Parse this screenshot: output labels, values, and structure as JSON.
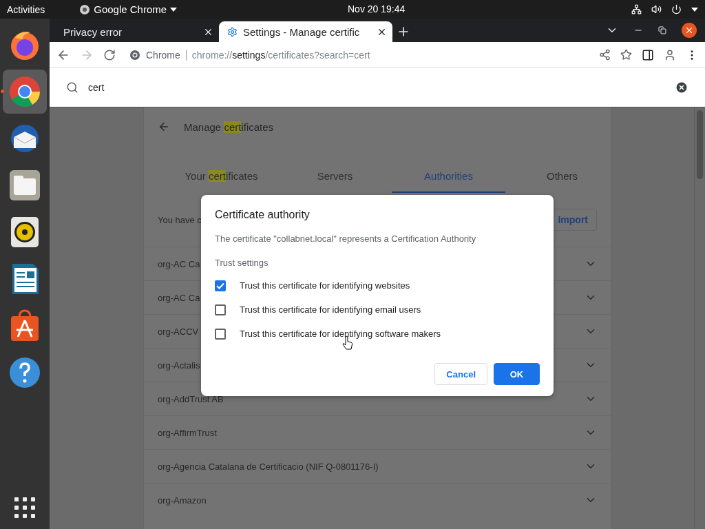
{
  "top_bar": {
    "activities": "Activities",
    "app_menu": "Google Chrome",
    "clock": "Nov 20  19:44"
  },
  "dock": [
    {
      "kind": "firefox",
      "selected": false
    },
    {
      "kind": "chrome",
      "selected": true
    },
    {
      "kind": "mail",
      "selected": false
    },
    {
      "kind": "files",
      "selected": false
    },
    {
      "kind": "music",
      "selected": false
    },
    {
      "kind": "writer",
      "selected": false
    },
    {
      "kind": "software",
      "selected": false
    },
    {
      "kind": "help",
      "selected": false
    }
  ],
  "tabs": [
    {
      "title": "Privacy error",
      "selected": false
    },
    {
      "title": "Settings - Manage certific",
      "selected": true
    }
  ],
  "address_bar": {
    "site": "Chrome",
    "url": [
      {
        "text": "chrome://",
        "emphasis": false
      },
      {
        "text": "settings",
        "emphasis": true
      },
      {
        "text": "/certificates?search=cert",
        "emphasis": false
      }
    ]
  },
  "settings_search": {
    "value": "cert"
  },
  "page": {
    "title": [
      {
        "text": "Manage ",
        "highlighted": false
      },
      {
        "text": "cert",
        "highlighted": true
      },
      {
        "text": "ificates",
        "highlighted": false
      }
    ],
    "tabs": [
      {
        "label": [
          {
            "text": "Your ",
            "highlighted": false
          },
          {
            "text": "cert",
            "highlighted": true
          },
          {
            "text": "ificates",
            "highlighted": false
          }
        ],
        "selected": false
      },
      {
        "label": [
          {
            "text": "Servers",
            "highlighted": false
          }
        ],
        "selected": false
      },
      {
        "label": [
          {
            "text": "Authorities",
            "highlighted": false
          }
        ],
        "selected": true
      },
      {
        "label": [
          {
            "text": "Others",
            "highlighted": false
          }
        ],
        "selected": false
      }
    ],
    "intro": "You have c",
    "import_button": "Import",
    "rows": [
      "org-AC Ca",
      "org-AC Ca",
      "org-ACCV",
      "org-Actalis",
      "org-AddTrust AB",
      "org-AffirmTrust",
      "org-Agencia Catalana de Certificacio (NIF Q-0801176-I)",
      "org-Amazon"
    ]
  },
  "dialog": {
    "title": "Certificate authority",
    "description": "The certificate \"collabnet.local\" represents a Certification Authority",
    "section": "Trust settings",
    "options": [
      {
        "label": "Trust this certificate for identifying websites",
        "checked": true
      },
      {
        "label": "Trust this certificate for identifying email users",
        "checked": false
      },
      {
        "label": "Trust this certificate for identifying software makers",
        "checked": false
      }
    ],
    "cancel": "Cancel",
    "ok": "OK"
  }
}
